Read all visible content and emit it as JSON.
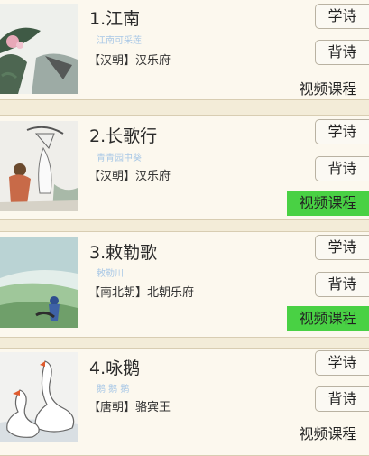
{
  "colors": {
    "highlight": "#49d144",
    "card": "#fcf8ee",
    "page": "#f3ecd8"
  },
  "poems": [
    {
      "number_title": "1.江南",
      "first_line": "江南可采莲",
      "dynasty_author": "【汉朝】汉乐府",
      "learn": "学诗",
      "recite": "背诗",
      "video": "视频课程",
      "video_highlighted": false,
      "image": "lotus-painting"
    },
    {
      "number_title": "2.长歌行",
      "first_line": "青青园中葵",
      "dynasty_author": "【汉朝】汉乐府",
      "learn": "学诗",
      "recite": "背诗",
      "video": "视频课程",
      "video_highlighted": true,
      "image": "figures-painting"
    },
    {
      "number_title": "3.敕勒歌",
      "first_line": "敕勒川",
      "dynasty_author": "【南北朝】北朝乐府",
      "learn": "学诗",
      "recite": "背诗",
      "video": "视频课程",
      "video_highlighted": true,
      "image": "grassland-painting"
    },
    {
      "number_title": "4.咏鹅",
      "first_line": "鹅 鹅 鹅",
      "dynasty_author": "【唐朝】骆宾王",
      "learn": "学诗",
      "recite": "背诗",
      "video": "视频课程",
      "video_highlighted": false,
      "image": "geese-painting"
    }
  ]
}
